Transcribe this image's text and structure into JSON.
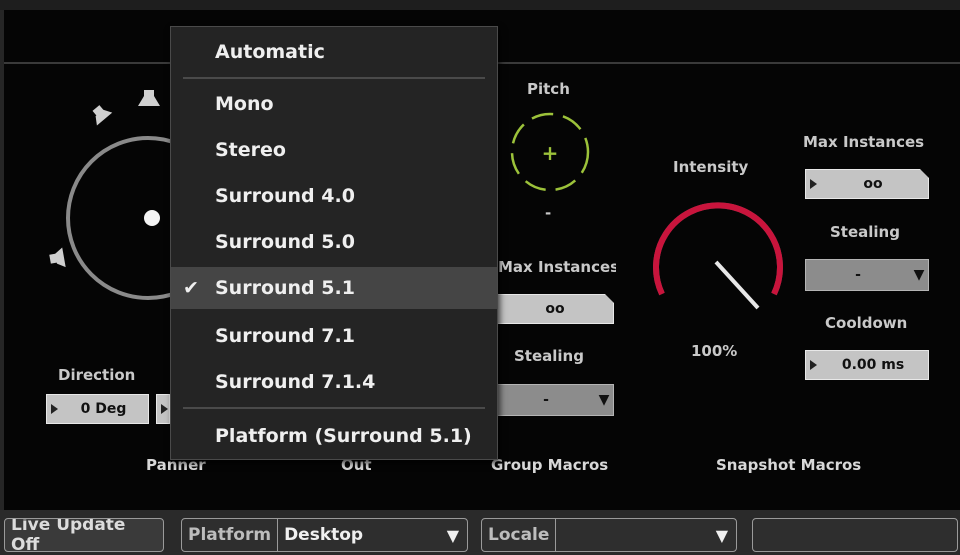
{
  "panels": {
    "panner_label": "Panner",
    "out_label": "Out",
    "group_macros_label": "Group Macros",
    "snapshot_macros_label": "Snapshot Macros"
  },
  "panner": {
    "direction_label": "Direction",
    "direction_value": "0 Deg"
  },
  "group_macros": {
    "pitch_label": "Pitch",
    "pitch_value": "-",
    "max_instances_label": "Max Instances",
    "max_instances_value": "oo",
    "stealing_label": "Stealing",
    "stealing_value": "-"
  },
  "snapshot_macros": {
    "intensity_label": "Intensity",
    "intensity_value": "100%",
    "intensity_level": 1.0,
    "max_instances_label": "Max Instances",
    "max_instances_value": "oo",
    "stealing_label": "Stealing",
    "stealing_value": "-",
    "cooldown_label": "Cooldown",
    "cooldown_value": "0.00 ms"
  },
  "dropdown": {
    "selected": "Surround 5.1",
    "items": {
      "automatic": "Automatic",
      "mono": "Mono",
      "stereo": "Stereo",
      "surround_40": "Surround 4.0",
      "surround_50": "Surround 5.0",
      "surround_51": "Surround 5.1",
      "surround_71": "Surround 7.1",
      "surround_714": "Surround 7.1.4",
      "platform": "Platform (Surround 5.1)"
    },
    "check_glyph": "✔"
  },
  "toolbar": {
    "live_update": "Live Update Off",
    "platform_label": "Platform",
    "platform_value": "Desktop",
    "locale_label": "Locale",
    "locale_value": ""
  },
  "colors": {
    "intensity_arc": "#c8143c",
    "pitch_dial": "#9cc23a"
  }
}
